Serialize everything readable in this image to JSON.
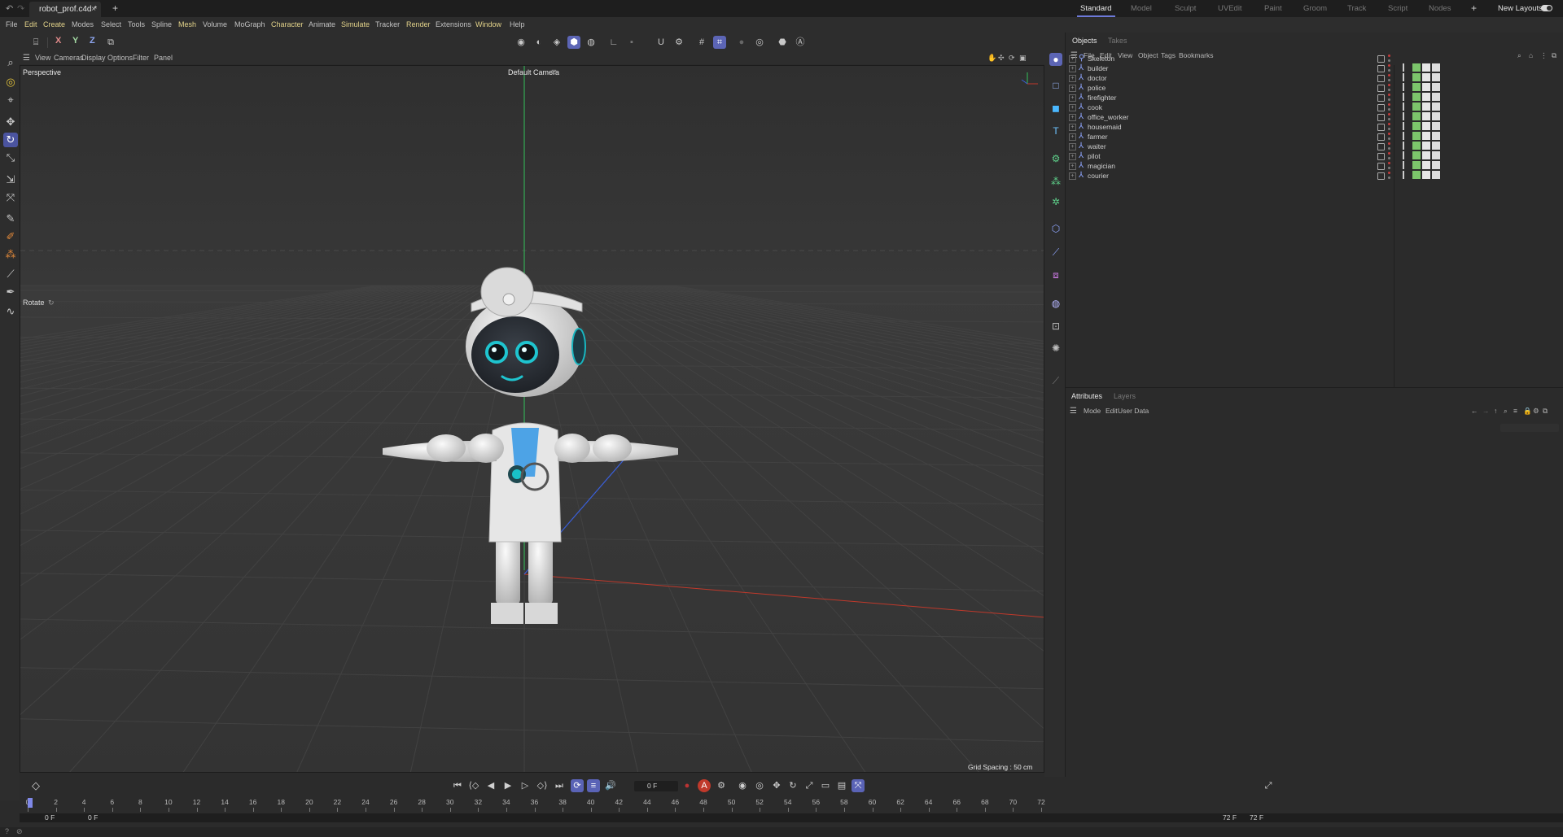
{
  "document_tab": {
    "title": "robot_prof.c4d *",
    "close": "×",
    "new": "+"
  },
  "layouts": {
    "tabs": [
      "Standard",
      "Model",
      "Sculpt",
      "UVEdit",
      "Paint",
      "Groom",
      "Track",
      "Script",
      "Nodes"
    ],
    "active": "Standard",
    "add": "+",
    "new_layouts": "New Layouts"
  },
  "menubar": [
    {
      "label": "File",
      "hl": false
    },
    {
      "label": "Edit",
      "hl": true
    },
    {
      "label": "Create",
      "hl": true
    },
    {
      "label": "Modes",
      "hl": false
    },
    {
      "label": "Select",
      "hl": false
    },
    {
      "label": "Tools",
      "hl": false
    },
    {
      "label": "Spline",
      "hl": false
    },
    {
      "label": "Mesh",
      "hl": true
    },
    {
      "label": "Volume",
      "hl": false
    },
    {
      "label": "MoGraph",
      "hl": false
    },
    {
      "label": "Character",
      "hl": true
    },
    {
      "label": "Animate",
      "hl": false
    },
    {
      "label": "Simulate",
      "hl": true
    },
    {
      "label": "Tracker",
      "hl": false
    },
    {
      "label": "Render",
      "hl": true
    },
    {
      "label": "Extensions",
      "hl": false
    },
    {
      "label": "Window",
      "hl": true
    },
    {
      "label": "Help",
      "hl": false
    }
  ],
  "axis_lock": {
    "x": "X",
    "y": "Y",
    "z": "Z"
  },
  "viewport": {
    "menu": [
      "View",
      "Cameras",
      "Display",
      "Options",
      "Filter",
      "Panel"
    ],
    "projection": "Perspective",
    "camera": "Default Camera",
    "tool_hint": "Rotate",
    "grid_spacing": "Grid Spacing : 50 cm"
  },
  "objects_panel": {
    "tabs": [
      "Objects",
      "Takes"
    ],
    "active_tab": "Objects",
    "menu": [
      "File",
      "Edit",
      "View",
      "Object",
      "Tags",
      "Bookmarks"
    ],
    "objects": [
      "Skeleton",
      "builder",
      "doctor",
      "police",
      "firefighter",
      "cook",
      "office_worker",
      "housemaid",
      "farmer",
      "waiter",
      "pilot",
      "magician",
      "courier"
    ]
  },
  "attributes_panel": {
    "tabs": [
      "Attributes",
      "Layers"
    ],
    "active_tab": "Attributes",
    "menu": [
      "Mode",
      "Edit",
      "User Data"
    ]
  },
  "timeline": {
    "current_frame": "0 F",
    "ruler_labels": [
      "0",
      "2",
      "4",
      "6",
      "8",
      "10",
      "12",
      "14",
      "16",
      "18",
      "20",
      "22",
      "24",
      "26",
      "28",
      "30",
      "32",
      "34",
      "36",
      "38",
      "40",
      "42",
      "44",
      "46",
      "48",
      "50",
      "52",
      "54",
      "56",
      "58",
      "60",
      "62",
      "64",
      "66",
      "68",
      "70",
      "72"
    ],
    "range_start": "0 F",
    "range_start2": "0 F",
    "range_end": "72 F",
    "range_end2": "72 F"
  },
  "colors": {
    "accent": "#5c65b5",
    "menu_highlight": "#e3d38a",
    "x_axis": "#c0392b",
    "y_axis": "#2ecc71",
    "z_axis": "#3a5fd8"
  }
}
